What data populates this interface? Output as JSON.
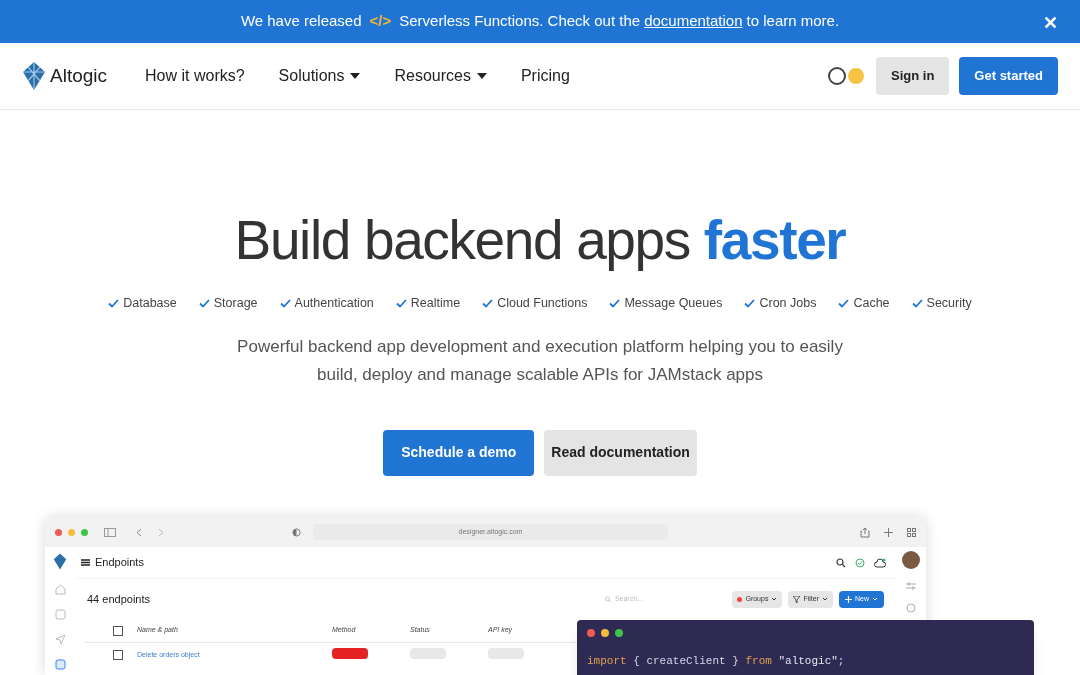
{
  "banner": {
    "before": "We have released",
    "code_icon": "</>",
    "middle": "Serverless Functions. Check out the",
    "link": "documentation",
    "after": "to learn more.",
    "close": "✕"
  },
  "nav": {
    "brand": "Altogic",
    "links": [
      {
        "label": "How it works?",
        "dropdown": false
      },
      {
        "label": "Solutions",
        "dropdown": true
      },
      {
        "label": "Resources",
        "dropdown": true
      },
      {
        "label": "Pricing",
        "dropdown": false
      }
    ],
    "theme_dark": false,
    "sign_in": "Sign in",
    "get_started": "Get started"
  },
  "hero": {
    "title": "Build backend apps",
    "highlight": "faster",
    "features": [
      "Database",
      "Storage",
      "Authentication",
      "Realtime",
      "Cloud Functions",
      "Message Queues",
      "Cron Jobs",
      "Cache",
      "Security"
    ],
    "subtitle": "Powerful backend app development and execution platform helping you to easily build, deploy and manage scalable APIs for JAMstack apps",
    "buttons": [
      "Schedule a demo",
      "Read documentation"
    ]
  },
  "app_preview": {
    "url": "designer.altogic.com",
    "page_title": "Endpoints",
    "count": "44 endpoints",
    "search_placeholder": "Search...",
    "groups": "Groups",
    "filter": "Filter",
    "new": "New",
    "columns": [
      "Name & path",
      "Method",
      "Status",
      "API key"
    ],
    "select_all_checked": false,
    "rows": [
      {
        "name": "Delete orders object",
        "checked": false
      }
    ]
  },
  "code_window": {
    "lines": [
      [
        {
          "text": "import",
          "kind": "keyword"
        },
        {
          "text": " { createClient } ",
          "kind": "plain"
        },
        {
          "text": "from",
          "kind": "keyword"
        },
        {
          "text": " \"altogic\"",
          "kind": "string"
        },
        {
          "text": ";",
          "kind": "plain"
        }
      ]
    ]
  }
}
